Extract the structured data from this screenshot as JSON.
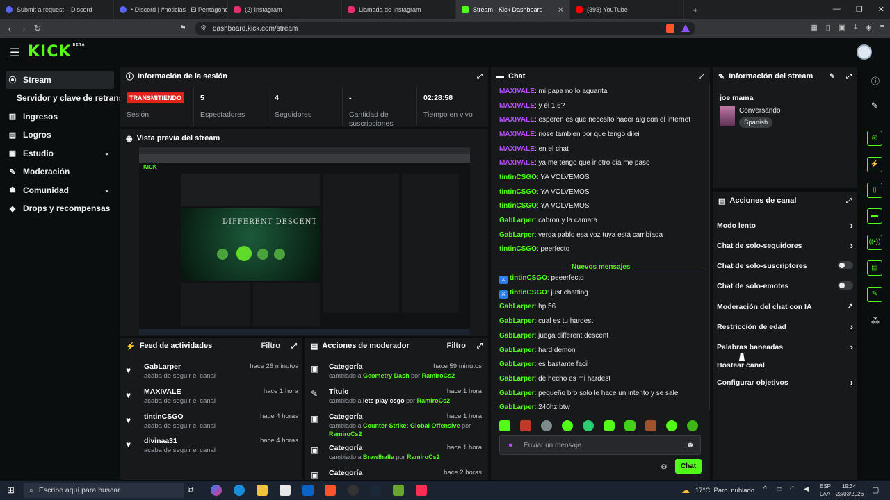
{
  "browser": {
    "tabs": [
      {
        "label": "Submit a request – Discord",
        "color": "#5865f2"
      },
      {
        "label": "• Discord | #noticias | El Pentágono",
        "color": "#5865f2"
      },
      {
        "label": "(2) Instagram",
        "color": "#e1306c"
      },
      {
        "label": "Llamada de Instagram",
        "color": "#e1306c"
      },
      {
        "label": "Stream - Kick Dashboard",
        "color": "#53fc18"
      },
      {
        "label": "(393) YouTube",
        "color": "#ff0000"
      }
    ],
    "url": "dashboard.kick.com/stream"
  },
  "brand": {
    "logo": "KICK",
    "beta": "BETA",
    "accent": "#53fc18"
  },
  "sidebar": {
    "items": [
      {
        "label": "Stream",
        "icon": "radio-icon"
      },
      {
        "label": "Servidor y clave de retransm"
      },
      {
        "label": "Ingresos",
        "icon": "chart-icon"
      },
      {
        "label": "Logros",
        "icon": "trophy-icon"
      },
      {
        "label": "Estudio",
        "icon": "studio-icon"
      },
      {
        "label": "Moderación",
        "icon": "wrench-icon"
      },
      {
        "label": "Comunidad",
        "icon": "people-icon"
      },
      {
        "label": "Drops y recompensas",
        "icon": "gift-icon"
      }
    ]
  },
  "session": {
    "title": "Información de la sesión",
    "status_badge": "TRANSMITIENDO",
    "status_label": "Sesión",
    "viewers_value": "5",
    "viewers_label": "Espectadores",
    "followers_value": "4",
    "followers_label": "Seguidores",
    "subs_value": "-",
    "subs_label": "Cantidad de suscripciones",
    "time_value": "02:28:58",
    "time_label": "Tiempo en vivo"
  },
  "preview": {
    "title": "Vista previa del stream"
  },
  "activity": {
    "title": "Feed de actividades",
    "filter": "Filtro",
    "items": [
      {
        "name": "GabLarper",
        "time": "hace 26 minutos",
        "sub": "acaba de seguir el canal"
      },
      {
        "name": "MAXIVALE",
        "time": "hace 1 hora",
        "sub": "acaba de seguir el canal"
      },
      {
        "name": "tintinCSGO",
        "time": "hace 4 horas",
        "sub": "acaba de seguir el canal"
      },
      {
        "name": "divinaa31",
        "time": "hace 4 horas",
        "sub": "acaba de seguir el canal"
      }
    ]
  },
  "modactions": {
    "title": "Acciones de moderador",
    "filter": "Filtro",
    "items": [
      {
        "name": "Categoría",
        "time": "hace 59 minutos",
        "pre": "cambiado a",
        "val": "Geometry Dash",
        "por": "por",
        "user": "RamiroCs2"
      },
      {
        "name": "Título",
        "time": "hace 1 hora",
        "pre": "cambiado a",
        "val": "lets play csgo",
        "por": "por",
        "user": "RamiroCs2"
      },
      {
        "name": "Categoría",
        "time": "hace 1 hora",
        "pre": "cambiado a",
        "val": "Counter-Strike: Global Offensive",
        "por": "por",
        "user": "RamiroCs2"
      },
      {
        "name": "Categoría",
        "time": "hace 1 hora",
        "pre": "cambiado a",
        "val": "Brawlhalla",
        "por": "por",
        "user": "RamiroCs2"
      },
      {
        "name": "Categoría",
        "time": "hace 2 horas"
      }
    ]
  },
  "chat": {
    "title": "Chat",
    "divider": "Nuevos mensajes",
    "messages": [
      {
        "user": "MAXIVALE",
        "color": "#b84dff",
        "text": "mi papa no lo aguanta"
      },
      {
        "user": "MAXIVALE",
        "color": "#b84dff",
        "text": "y el 1.6?"
      },
      {
        "user": "MAXIVALE",
        "color": "#b84dff",
        "text": "esperen es que necesito hacer alg con el internet"
      },
      {
        "user": "MAXIVALE",
        "color": "#b84dff",
        "text": "nose tambien por que tengo dilei"
      },
      {
        "user": "MAXIVALE",
        "color": "#b84dff",
        "text": "en el chat"
      },
      {
        "user": "MAXIVALE",
        "color": "#b84dff",
        "text": "ya me tengo que ir otro dia me paso"
      },
      {
        "user": "tintinCSGO",
        "color": "#53fc18",
        "text": "YA VOLVEMOS"
      },
      {
        "user": "tintinCSGO",
        "color": "#53fc18",
        "text": "YA VOLVEMOS"
      },
      {
        "user": "tintinCSGO",
        "color": "#53fc18",
        "text": "YA VOLVEMOS"
      },
      {
        "user": "GabLarper",
        "color": "#53fc18",
        "text": "cabron y la camara"
      },
      {
        "user": "GabLarper",
        "color": "#53fc18",
        "text": "verga pablo esa voz tuya está cambiada"
      },
      {
        "user": "tintinCSGO",
        "color": "#53fc18",
        "text": "peerfecto"
      },
      {
        "user": "tintinCSGO",
        "color": "#53fc18",
        "text": "peeerfecto",
        "mod": true
      },
      {
        "user": "tintinCSGO",
        "color": "#53fc18",
        "text": "just chatting",
        "mod": true
      },
      {
        "user": "GabLarper",
        "color": "#53fc18",
        "text": "hp 56"
      },
      {
        "user": "GabLarper",
        "color": "#53fc18",
        "text": "cual es tu hardest"
      },
      {
        "user": "GabLarper",
        "color": "#53fc18",
        "text": "juega different descent"
      },
      {
        "user": "GabLarper",
        "color": "#53fc18",
        "text": "hard demon"
      },
      {
        "user": "GabLarper",
        "color": "#53fc18",
        "text": "es bastante facil"
      },
      {
        "user": "GabLarper",
        "color": "#53fc18",
        "text": "de hecho es mi hardest"
      },
      {
        "user": "GabLarper",
        "color": "#53fc18",
        "text": "pequeño bro solo le hace un intento y se sale"
      },
      {
        "user": "GabLarper",
        "color": "#53fc18",
        "text": "240hz btw"
      }
    ],
    "input_placeholder": "Enviar un mensaje",
    "send_label": "Chat"
  },
  "streaminfo": {
    "title": "Información del stream",
    "stream_title": "joe mama",
    "category": "Conversando",
    "language": "Spanish"
  },
  "channel": {
    "title": "Acciones de canal",
    "actions": [
      {
        "label": "Modo lento",
        "kind": "chevron"
      },
      {
        "label": "Chat de solo-seguidores",
        "kind": "chevron"
      },
      {
        "label": "Chat de solo-suscriptores",
        "kind": "toggle"
      },
      {
        "label": "Chat de solo-emotes",
        "kind": "toggle"
      },
      {
        "label": "Moderación del chat con IA",
        "kind": "external"
      },
      {
        "label": "Restricción de edad",
        "kind": "chevron"
      },
      {
        "label": "Palabras baneadas",
        "kind": "chevron"
      },
      {
        "label": "Hostear canal",
        "kind": "none"
      },
      {
        "label": "Configurar objetivos",
        "kind": "chevron"
      }
    ]
  },
  "taskbar": {
    "search_placeholder": "Escribe aquí para buscar.",
    "weather": "17°C  Parc. nublado",
    "lang1": "ESP",
    "lang2": "LAA",
    "time": "19:34",
    "date": "23/03/2026"
  }
}
